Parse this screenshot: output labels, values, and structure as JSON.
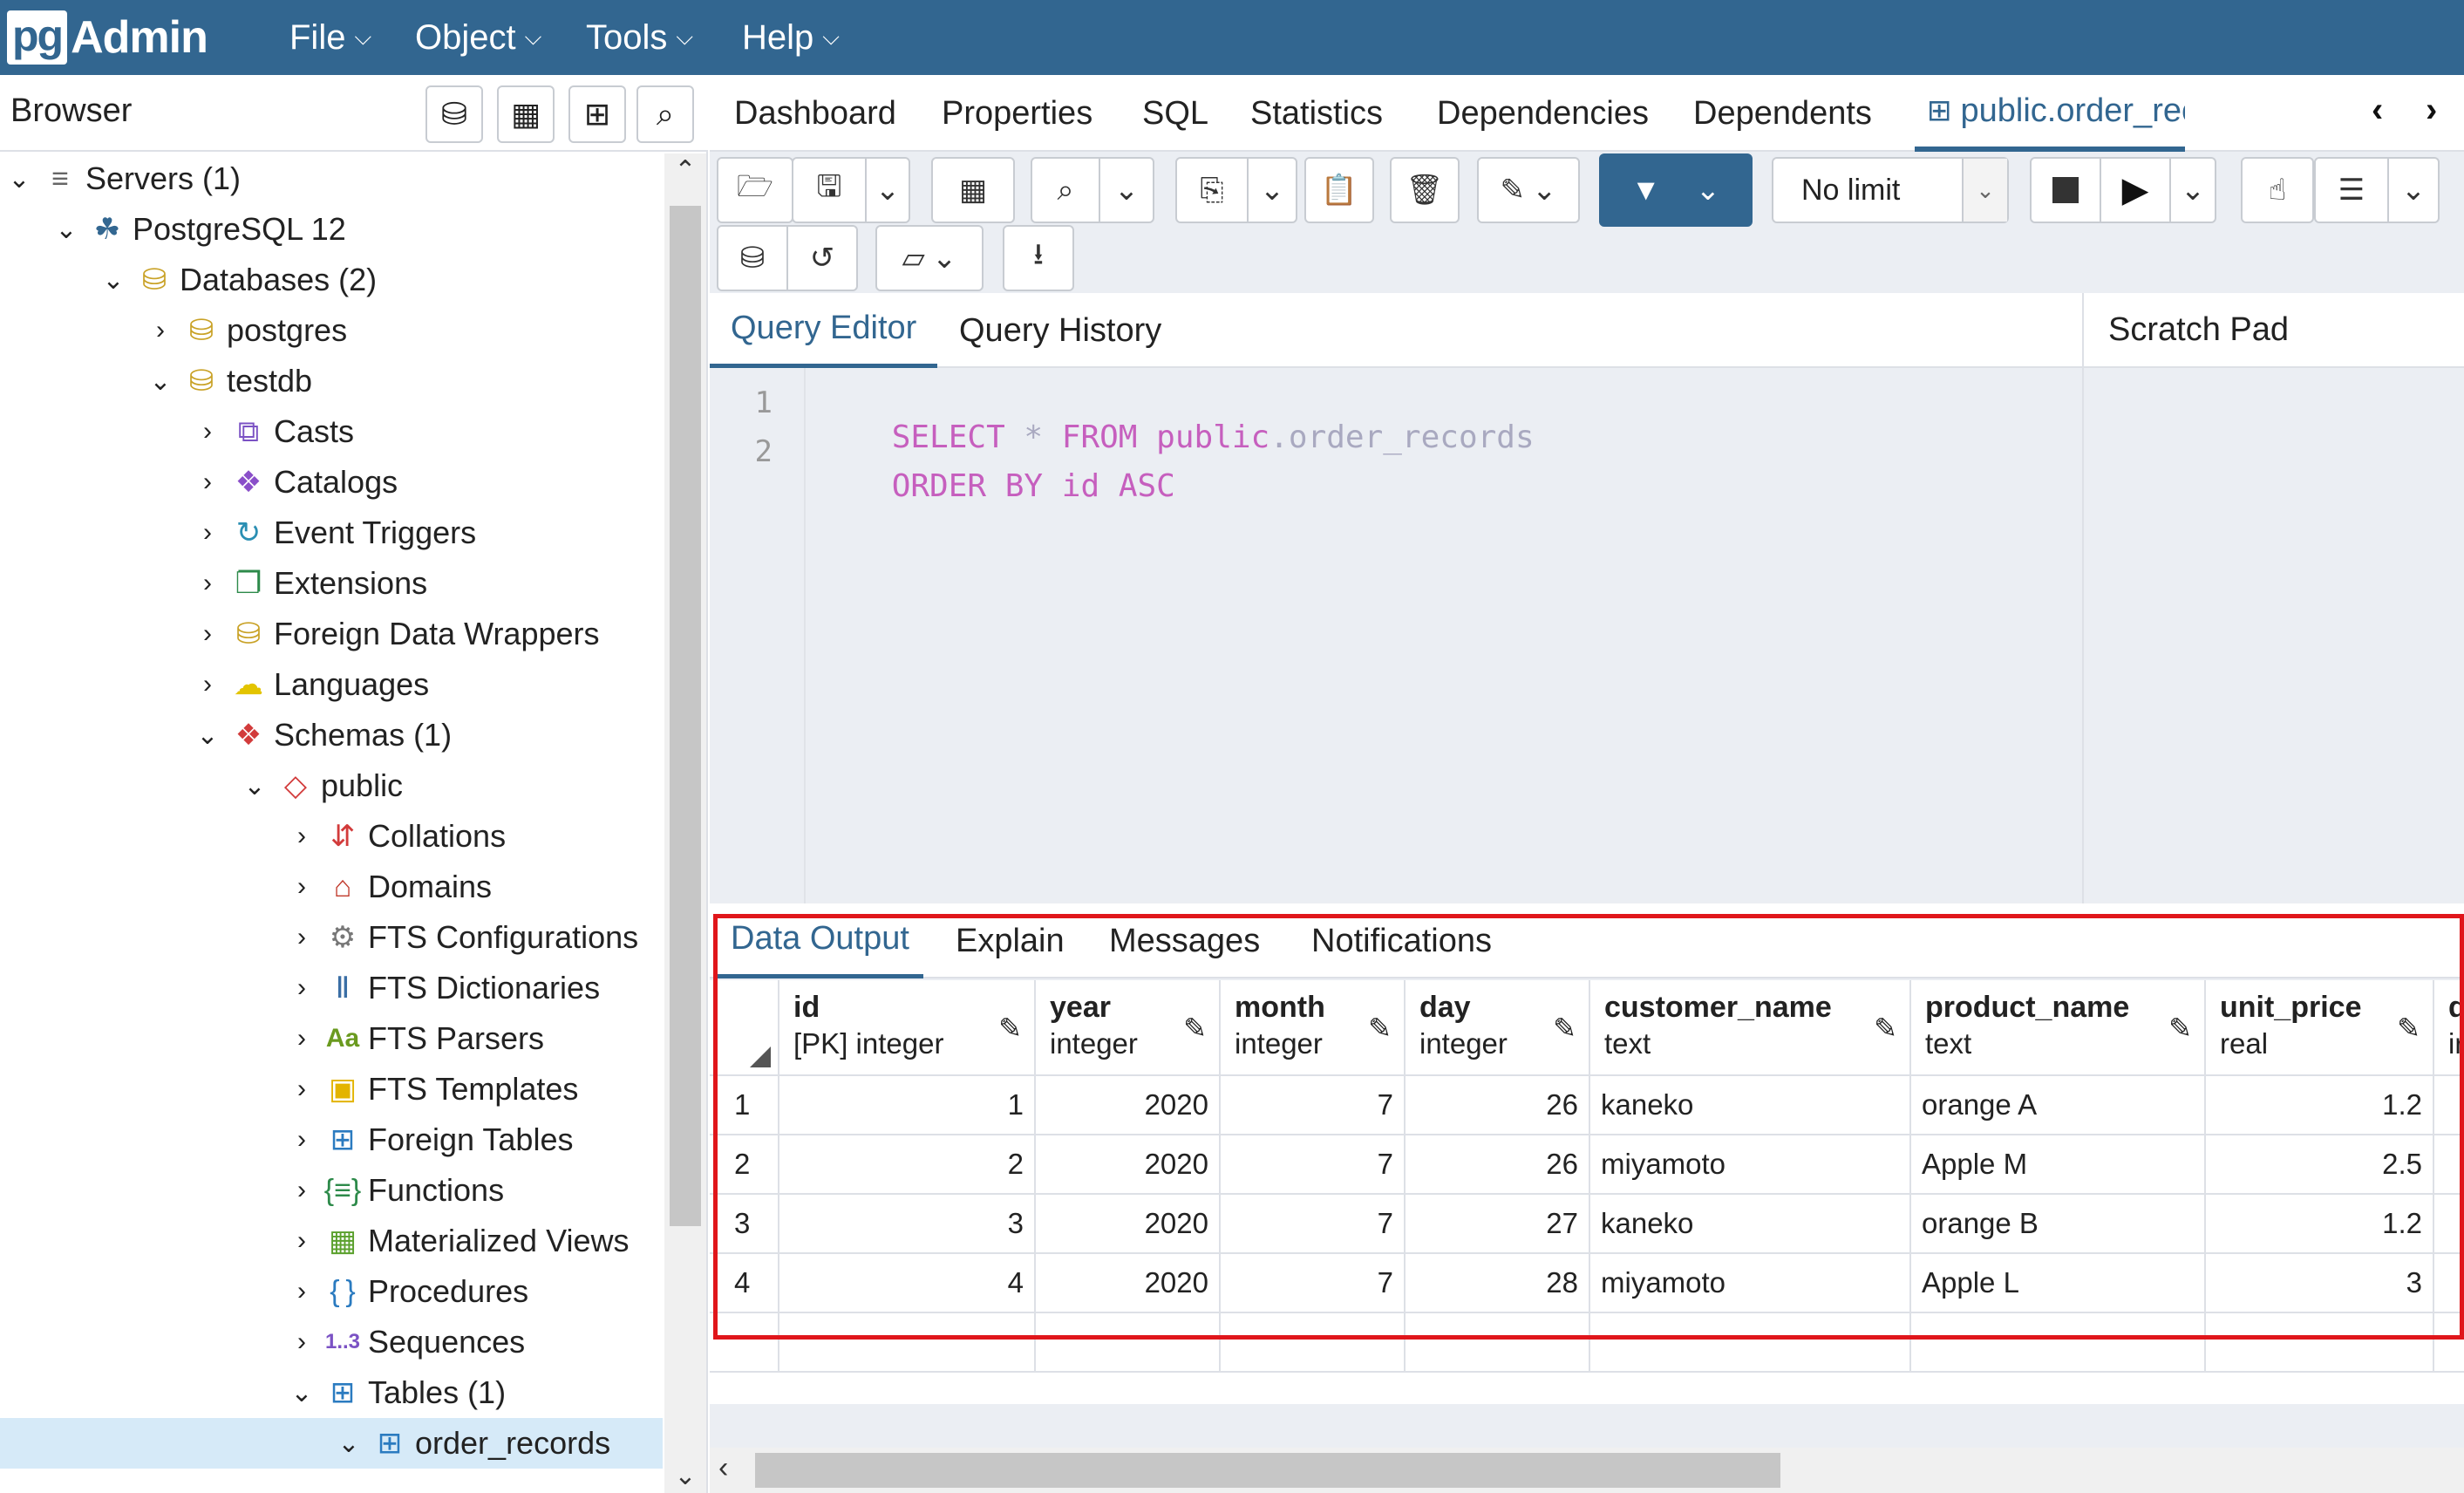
{
  "navbar": {
    "logo_pg": "pg",
    "logo_admin": "Admin",
    "menus": [
      "File",
      "Object",
      "Tools",
      "Help"
    ]
  },
  "browser": {
    "title": "Browser",
    "tree": [
      {
        "label": "Servers (1)",
        "toggle": "v",
        "icon": "servers-icon"
      },
      {
        "label": "PostgreSQL 12",
        "toggle": "v",
        "icon": "elephant-icon"
      },
      {
        "label": "Databases (2)",
        "toggle": "v",
        "icon": "databases-icon"
      },
      {
        "label": "postgres",
        "toggle": ">",
        "icon": "database-icon"
      },
      {
        "label": "testdb",
        "toggle": "v",
        "icon": "database-icon"
      },
      {
        "label": "Casts",
        "toggle": ">",
        "icon": "casts-icon"
      },
      {
        "label": "Catalogs",
        "toggle": ">",
        "icon": "catalogs-icon"
      },
      {
        "label": "Event Triggers",
        "toggle": ">",
        "icon": "event-triggers-icon"
      },
      {
        "label": "Extensions",
        "toggle": ">",
        "icon": "extensions-icon"
      },
      {
        "label": "Foreign Data Wrappers",
        "toggle": ">",
        "icon": "foreign-data-wrappers-icon"
      },
      {
        "label": "Languages",
        "toggle": ">",
        "icon": "languages-icon"
      },
      {
        "label": "Schemas (1)",
        "toggle": "v",
        "icon": "schemas-icon"
      },
      {
        "label": "public",
        "toggle": "v",
        "icon": "schema-icon"
      },
      {
        "label": "Collations",
        "toggle": ">",
        "icon": "collations-icon"
      },
      {
        "label": "Domains",
        "toggle": ">",
        "icon": "domains-icon"
      },
      {
        "label": "FTS Configurations",
        "toggle": ">",
        "icon": "fts-configurations-icon"
      },
      {
        "label": "FTS Dictionaries",
        "toggle": ">",
        "icon": "fts-dictionaries-icon"
      },
      {
        "label": "FTS Parsers",
        "toggle": ">",
        "icon": "fts-parsers-icon"
      },
      {
        "label": "FTS Templates",
        "toggle": ">",
        "icon": "fts-templates-icon"
      },
      {
        "label": "Foreign Tables",
        "toggle": ">",
        "icon": "foreign-tables-icon"
      },
      {
        "label": "Functions",
        "toggle": ">",
        "icon": "functions-icon"
      },
      {
        "label": "Materialized Views",
        "toggle": ">",
        "icon": "materialized-views-icon"
      },
      {
        "label": "Procedures",
        "toggle": ">",
        "icon": "procedures-icon"
      },
      {
        "label": "Sequences",
        "toggle": ">",
        "icon": "sequences-icon"
      },
      {
        "label": "Tables (1)",
        "toggle": "v",
        "icon": "tables-icon"
      },
      {
        "label": "order_records",
        "toggle": "v",
        "icon": "table-icon"
      }
    ]
  },
  "main_tabs": [
    "Dashboard",
    "Properties",
    "SQL",
    "Statistics",
    "Dependencies",
    "Dependents",
    "public.order_records/testd"
  ],
  "toolbar": {
    "limit_value": "No limit"
  },
  "editor": {
    "tabs": [
      "Query Editor",
      "Query History"
    ],
    "scratch_pad": "Scratch Pad",
    "lines": [
      {
        "no": "1",
        "parts": [
          [
            "kw",
            "SELECT"
          ],
          [
            "plain",
            " * "
          ],
          [
            "kw",
            "FROM"
          ],
          [
            "plain",
            " "
          ],
          [
            "kw",
            "public"
          ],
          [
            "plain",
            ".order_records"
          ]
        ]
      },
      {
        "no": "2",
        "parts": [
          [
            "kw",
            "ORDER BY"
          ],
          [
            "plain",
            " "
          ],
          [
            "fld",
            "id"
          ],
          [
            "plain",
            " "
          ],
          [
            "kw",
            "ASC"
          ]
        ]
      }
    ]
  },
  "output": {
    "tabs": [
      "Data Output",
      "Explain",
      "Messages",
      "Notifications"
    ],
    "columns": [
      {
        "name": "id",
        "type": "[PK] integer"
      },
      {
        "name": "year",
        "type": "integer"
      },
      {
        "name": "month",
        "type": "integer"
      },
      {
        "name": "day",
        "type": "integer"
      },
      {
        "name": "customer_name",
        "type": "text"
      },
      {
        "name": "product_name",
        "type": "text"
      },
      {
        "name": "unit_price",
        "type": "real"
      },
      {
        "name": "q",
        "type": "ir"
      }
    ],
    "rows": [
      {
        "n": "1",
        "cells": [
          "1",
          "2020",
          "7",
          "26",
          "kaneko",
          "orange A",
          "1.2"
        ]
      },
      {
        "n": "2",
        "cells": [
          "2",
          "2020",
          "7",
          "26",
          "miyamoto",
          "Apple M",
          "2.5"
        ]
      },
      {
        "n": "3",
        "cells": [
          "3",
          "2020",
          "7",
          "27",
          "kaneko",
          "orange B",
          "1.2"
        ]
      },
      {
        "n": "4",
        "cells": [
          "4",
          "2020",
          "7",
          "28",
          "miyamoto",
          "Apple L",
          "3"
        ]
      }
    ]
  },
  "colors": {
    "navbar": "#326690",
    "accent": "#326690",
    "highlight": "#e0161b",
    "keyword": "#c65fbe"
  }
}
